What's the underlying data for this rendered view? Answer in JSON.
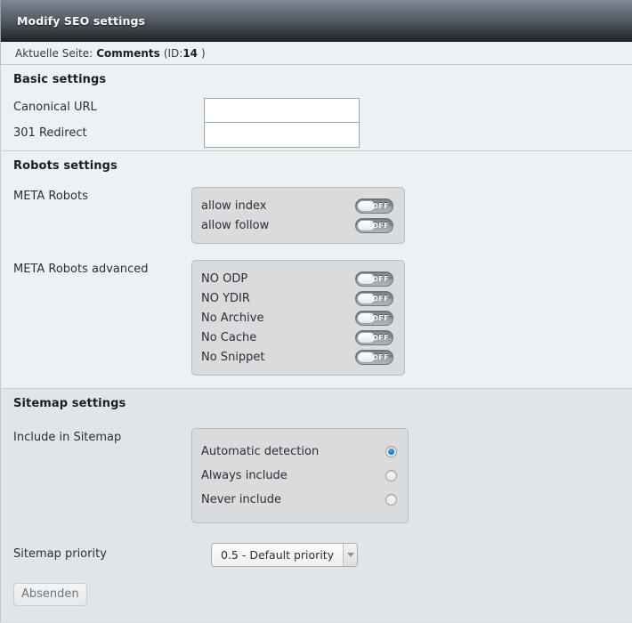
{
  "window": {
    "title": "Modify SEO settings"
  },
  "breadcrumb": {
    "label": "Aktuelle Seite:",
    "page_name": "Comments",
    "id_prefix": "(ID:",
    "id_value": "14",
    "id_suffix": ")"
  },
  "sections": {
    "basic": {
      "title": "Basic settings",
      "fields": [
        {
          "label": "Canonical URL",
          "value": "",
          "placeholder": ""
        },
        {
          "label": "301 Redirect",
          "value": "",
          "placeholder": ""
        }
      ]
    },
    "robots": {
      "title": "Robots settings",
      "meta_robots": {
        "label": "META Robots",
        "toggles": [
          {
            "label": "allow index",
            "state": "OFF",
            "on": false
          },
          {
            "label": "allow follow",
            "state": "OFF",
            "on": false
          }
        ]
      },
      "meta_robots_advanced": {
        "label": "META Robots advanced",
        "toggles": [
          {
            "label": "NO ODP",
            "state": "OFF",
            "on": false
          },
          {
            "label": "NO YDIR",
            "state": "OFF",
            "on": false
          },
          {
            "label": "No Archive",
            "state": "OFF",
            "on": false
          },
          {
            "label": "No Cache",
            "state": "OFF",
            "on": false
          },
          {
            "label": "No Snippet",
            "state": "OFF",
            "on": false
          }
        ]
      }
    },
    "sitemap": {
      "title": "Sitemap settings",
      "include": {
        "label": "Include in Sitemap",
        "options": [
          {
            "label": "Automatic detection",
            "selected": true
          },
          {
            "label": "Always include",
            "selected": false
          },
          {
            "label": "Never include",
            "selected": false
          }
        ]
      },
      "priority": {
        "label": "Sitemap priority",
        "selected": "0.5 - Default priority"
      }
    }
  },
  "form": {
    "submit_label": "Absenden"
  },
  "colors": {
    "accent_radio": "#1b7fc0",
    "bg_light": "#eef1f4",
    "bg_grey": "#e2e5e8",
    "panel": "#d9dbdd"
  }
}
